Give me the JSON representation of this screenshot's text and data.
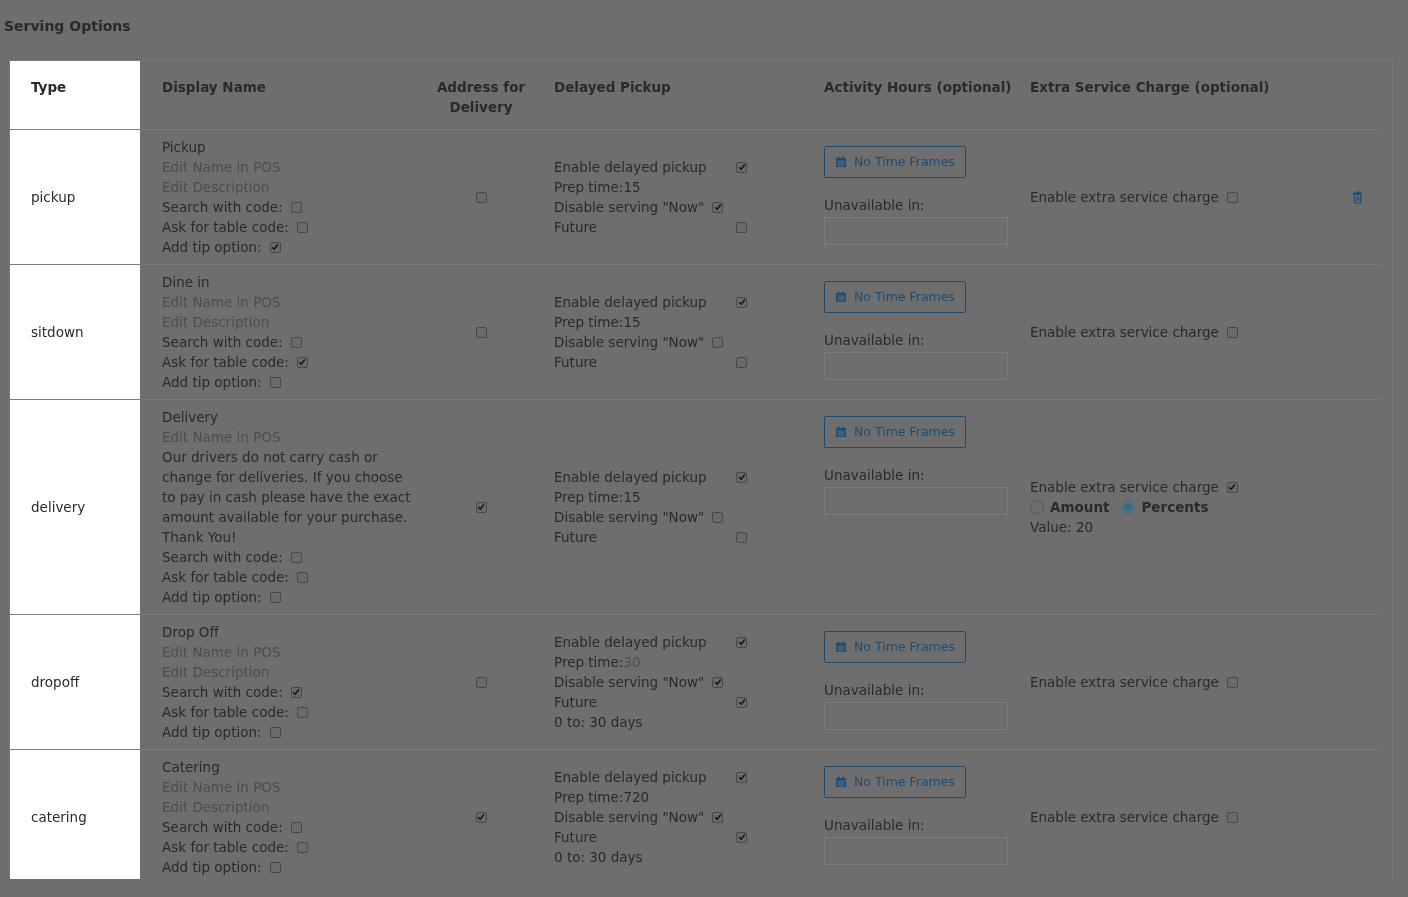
{
  "section_title": "Serving Options",
  "columns": [
    "Type",
    "Display Name",
    "Address for Delivery",
    "Delayed Pickup",
    "Activity Hours (optional)",
    "Extra Service Charge (optional)"
  ],
  "rows": [
    {
      "type": "pickup",
      "display_name": "Pickup",
      "edit_name": "Edit Name in POS",
      "description": "Edit Description",
      "description_set": false,
      "options": [
        {
          "label": "Search with code:",
          "checked": false
        },
        {
          "label": "Ask for table code:",
          "checked": false
        },
        {
          "label": "Add tip option:",
          "checked": true
        }
      ],
      "address_checked": false,
      "delayed": {
        "enable_label": "Enable delayed pickup",
        "enabled": true,
        "prep_label": "Prep time:",
        "prep_value": "15",
        "prep_muted": false,
        "disable_now_label": "Disable serving \"Now\"",
        "disable_now": true,
        "future_label": "Future",
        "future": false
      },
      "activity": {
        "button": "No Time Frames",
        "unavailable_label": "Unavailable in:"
      },
      "extra": {
        "label": "Enable extra service charge",
        "checked": false
      },
      "deletable": true
    },
    {
      "type": "sitdown",
      "display_name": "Dine in",
      "edit_name": "Edit Name in POS",
      "description": "Edit Description",
      "description_set": false,
      "options": [
        {
          "label": "Search with code:",
          "checked": false
        },
        {
          "label": "Ask for table code:",
          "checked": true
        },
        {
          "label": "Add tip option:",
          "checked": false
        }
      ],
      "address_checked": false,
      "delayed": {
        "enable_label": "Enable delayed pickup",
        "enabled": true,
        "prep_label": "Prep time:",
        "prep_value": "15",
        "prep_muted": false,
        "disable_now_label": "Disable serving \"Now\"",
        "disable_now": false,
        "future_label": "Future",
        "future": false
      },
      "activity": {
        "button": "No Time Frames",
        "unavailable_label": "Unavailable in:"
      },
      "extra": {
        "label": "Enable extra service charge",
        "checked": false
      },
      "deletable": false
    },
    {
      "type": "delivery",
      "display_name": "Delivery",
      "edit_name": "Edit Name in POS",
      "description": "Our drivers do not carry cash or change for deliveries. If you choose to pay in cash please have the exact amount available for your purchase. Thank You!",
      "description_set": true,
      "options": [
        {
          "label": "Search with code:",
          "checked": false
        },
        {
          "label": "Ask for table code:",
          "checked": false
        },
        {
          "label": "Add tip option:",
          "checked": false
        }
      ],
      "address_checked": true,
      "delayed": {
        "enable_label": "Enable delayed pickup",
        "enabled": true,
        "prep_label": "Prep time:",
        "prep_value": "15",
        "prep_muted": false,
        "disable_now_label": "Disable serving \"Now\"",
        "disable_now": false,
        "future_label": "Future",
        "future": false
      },
      "activity": {
        "button": "No Time Frames",
        "unavailable_label": "Unavailable in:"
      },
      "extra": {
        "label": "Enable extra service charge",
        "checked": true,
        "modes": [
          {
            "label": "Amount",
            "selected": false
          },
          {
            "label": "Percents",
            "selected": true
          }
        ],
        "value": "Value: 20"
      },
      "deletable": false
    },
    {
      "type": "dropoff",
      "display_name": "Drop Off",
      "edit_name": "Edit Name in POS",
      "description": "Edit Description",
      "description_set": false,
      "options": [
        {
          "label": "Search with code:",
          "checked": true
        },
        {
          "label": "Ask for table code:",
          "checked": false
        },
        {
          "label": "Add tip option:",
          "checked": false
        }
      ],
      "address_checked": false,
      "delayed": {
        "enable_label": "Enable delayed pickup",
        "enabled": true,
        "prep_label": "Prep time:",
        "prep_value": "30",
        "prep_muted": true,
        "disable_now_label": "Disable serving \"Now\"",
        "disable_now": true,
        "future_label": "Future",
        "future": true,
        "future_range": "0 to: 30 days"
      },
      "activity": {
        "button": "No Time Frames",
        "unavailable_label": "Unavailable in:"
      },
      "extra": {
        "label": "Enable extra service charge",
        "checked": false
      },
      "deletable": false
    },
    {
      "type": "catering",
      "display_name": "Catering",
      "edit_name": "Edit Name in POS",
      "description": "Edit Description",
      "description_set": false,
      "options": [
        {
          "label": "Search with code:",
          "checked": false
        },
        {
          "label": "Ask for table code:",
          "checked": false
        },
        {
          "label": "Add tip option:",
          "checked": false
        }
      ],
      "address_checked": true,
      "delayed": {
        "enable_label": "Enable delayed pickup",
        "enabled": true,
        "prep_label": "Prep time:",
        "prep_value": "720",
        "prep_muted": false,
        "disable_now_label": "Disable serving \"Now\"",
        "disable_now": true,
        "future_label": "Future",
        "future": true,
        "future_range": "0 to: 30 days"
      },
      "activity": {
        "button": "No Time Frames",
        "unavailable_label": "Unavailable in:"
      },
      "extra": {
        "label": "Enable extra service charge",
        "checked": false
      },
      "deletable": false
    }
  ]
}
